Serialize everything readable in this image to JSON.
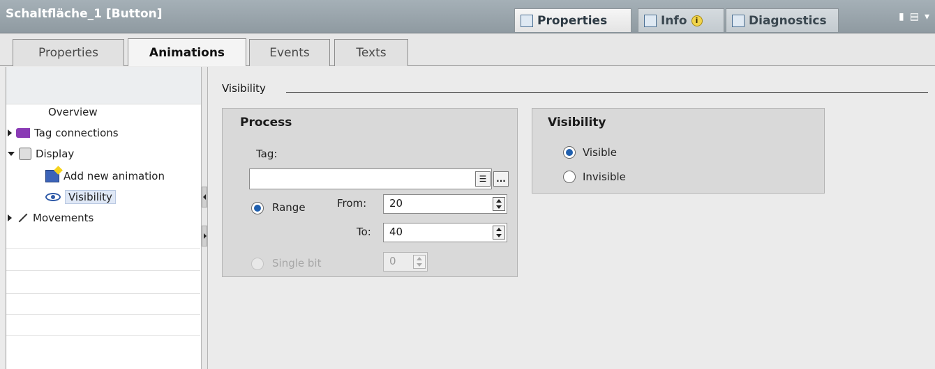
{
  "window": {
    "title": "Schaltfläche_1 [Button]",
    "tabs": [
      {
        "label": "Properties",
        "icon": "properties-icon"
      },
      {
        "label": "Info",
        "icon": "info-icon"
      },
      {
        "label": "Diagnostics",
        "icon": "diagnostics-icon"
      }
    ],
    "info_badge": "i"
  },
  "tabs": [
    "Properties",
    "Animations",
    "Events",
    "Texts"
  ],
  "tree": {
    "items": [
      {
        "label": "Overview"
      },
      {
        "label": "Tag connections"
      },
      {
        "label": "Display"
      },
      {
        "label": "Add new animation"
      },
      {
        "label": "Visibility"
      },
      {
        "label": "Movements"
      }
    ]
  },
  "section": {
    "title": "Visibility"
  },
  "process": {
    "title": "Process",
    "tag_label": "Tag:",
    "tag_value": "",
    "more_button": "...",
    "range_label": "Range",
    "from_label": "From:",
    "from_value": "20",
    "to_label": "To:",
    "to_value": "40",
    "single_bit_label": "Single bit",
    "single_bit_value": "0"
  },
  "visibility": {
    "title": "Visibility",
    "visible_label": "Visible",
    "invisible_label": "Invisible"
  }
}
